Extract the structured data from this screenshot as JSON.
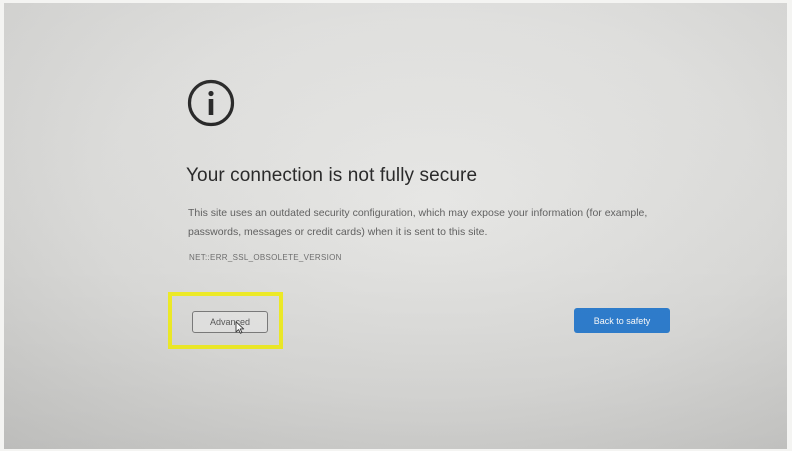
{
  "interstitial": {
    "icon": "info-circle-icon",
    "title": "Your connection is not fully secure",
    "description": "This site uses an outdated security configuration, which may expose your information (for example, passwords, messages or credit cards) when it is sent to this site.",
    "error_code": "NET::ERR_SSL_OBSOLETE_VERSION",
    "advanced_label": "Advanced",
    "back_to_safety_label": "Back to safety"
  },
  "annotation": {
    "highlight_color": "#f2ef28"
  },
  "colors": {
    "primary_button": "#2f7fd0",
    "title_text": "#232323",
    "body_text": "#5f5f5f"
  }
}
